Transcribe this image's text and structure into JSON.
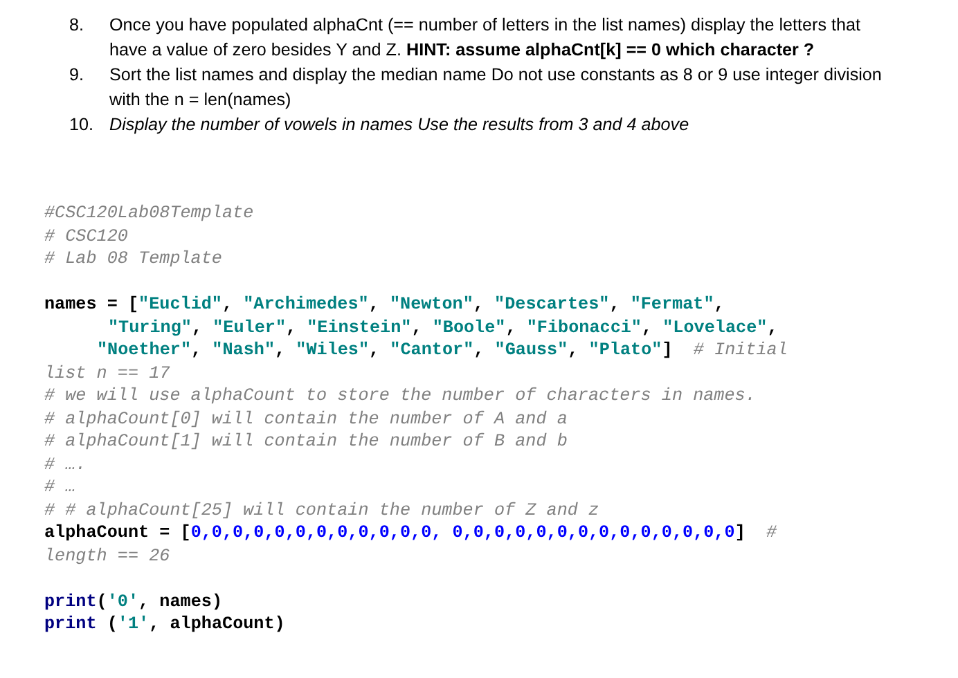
{
  "instructions": [
    {
      "number": "8.",
      "italic": false,
      "text": "Once you have populated alphaCnt (== number of letters in the list names) display the letters that have a value of zero besides Y and Z.  **HINT:  assume alphaCnt[k] == 0 which character ?**"
    },
    {
      "number": "9.",
      "italic": false,
      "text": "Sort the list names and display the median name   Do not use constants as 8 or 9 use integer division with the n = len(names)"
    },
    {
      "number": "10.",
      "italic": true,
      "text": "Display the number of vowels in names Use the results from 3 and 4 above"
    }
  ],
  "code_lines": [
    {
      "kind": "line",
      "tokens": [
        {
          "kind": "comment",
          "text": "#CSC120Lab08Template"
        }
      ]
    },
    {
      "kind": "line",
      "tokens": [
        {
          "kind": "comment",
          "text": "# CSC120"
        }
      ]
    },
    {
      "kind": "line",
      "tokens": [
        {
          "kind": "comment",
          "text": "# Lab 08 Template"
        }
      ]
    },
    {
      "kind": "line",
      "gap_before": true,
      "tokens": [
        {
          "kind": "plain",
          "text": "names = ["
        },
        {
          "kind": "string",
          "text": "\"Euclid\""
        },
        {
          "kind": "plain",
          "text": ", "
        },
        {
          "kind": "string",
          "text": "\"Archimedes\""
        },
        {
          "kind": "plain",
          "text": ", "
        },
        {
          "kind": "string",
          "text": "\"Newton\""
        },
        {
          "kind": "plain",
          "text": ", "
        },
        {
          "kind": "string",
          "text": "\"Descartes\""
        },
        {
          "kind": "plain",
          "text": ", "
        },
        {
          "kind": "string",
          "text": "\"Fermat\""
        },
        {
          "kind": "plain",
          "text": ","
        }
      ]
    },
    {
      "kind": "continuation",
      "tokens": [
        {
          "kind": "string",
          "text": "\"Turing\""
        },
        {
          "kind": "plain",
          "text": ", "
        },
        {
          "kind": "string",
          "text": "\"Euler\""
        },
        {
          "kind": "plain",
          "text": ", "
        },
        {
          "kind": "string",
          "text": "\"Einstein\""
        },
        {
          "kind": "plain",
          "text": ", "
        },
        {
          "kind": "string",
          "text": "\"Boole\""
        },
        {
          "kind": "plain",
          "text": ", "
        },
        {
          "kind": "string",
          "text": "\"Fibonacci\""
        },
        {
          "kind": "plain",
          "text": ", "
        },
        {
          "kind": "string",
          "text": "\"Lovelace\""
        },
        {
          "kind": "plain",
          "text": ","
        }
      ]
    },
    {
      "kind": "continuation_short",
      "tokens": [
        {
          "kind": "string",
          "text": "\"Noether\""
        },
        {
          "kind": "plain",
          "text": ", "
        },
        {
          "kind": "string",
          "text": "\"Nash\""
        },
        {
          "kind": "plain",
          "text": ", "
        },
        {
          "kind": "string",
          "text": "\"Wiles\""
        },
        {
          "kind": "plain",
          "text": ", "
        },
        {
          "kind": "string",
          "text": "\"Cantor\""
        },
        {
          "kind": "plain",
          "text": ", "
        },
        {
          "kind": "string",
          "text": "\"Gauss\""
        },
        {
          "kind": "plain",
          "text": ", "
        },
        {
          "kind": "string",
          "text": "\"Plato\""
        },
        {
          "kind": "plain",
          "text": "]  "
        },
        {
          "kind": "comment",
          "text": "# Initial"
        }
      ]
    },
    {
      "kind": "line",
      "tokens": [
        {
          "kind": "comment",
          "text": "list n == 17"
        }
      ]
    },
    {
      "kind": "line",
      "tokens": [
        {
          "kind": "comment",
          "text": "# we will use alphaCount to store the number of characters in names."
        }
      ]
    },
    {
      "kind": "line",
      "tokens": [
        {
          "kind": "comment",
          "text": "# alphaCount[0] will contain the number of A and a"
        }
      ]
    },
    {
      "kind": "line",
      "tokens": [
        {
          "kind": "comment",
          "text": "# alphaCount[1] will contain the number of B and b"
        }
      ]
    },
    {
      "kind": "line",
      "tokens": [
        {
          "kind": "comment",
          "text": "# …."
        }
      ]
    },
    {
      "kind": "line",
      "tokens": [
        {
          "kind": "comment",
          "text": "# …"
        }
      ]
    },
    {
      "kind": "line",
      "tokens": [
        {
          "kind": "comment",
          "text": "# # alphaCount[25] will contain the number of Z and z"
        }
      ]
    },
    {
      "kind": "line",
      "tokens": [
        {
          "kind": "plain",
          "text": "alphaCount = ["
        },
        {
          "kind": "number",
          "text": "0,0,0,0,0,0,0,0,0,0,0,0, 0,0,0,0,0,0,0,0,0,0,0,0,0,0"
        },
        {
          "kind": "plain",
          "text": "]  "
        },
        {
          "kind": "comment",
          "text": "#"
        }
      ]
    },
    {
      "kind": "line",
      "tokens": [
        {
          "kind": "comment",
          "text": "length == 26"
        }
      ]
    },
    {
      "kind": "line",
      "gap_before": true,
      "tokens": [
        {
          "kind": "keyword",
          "text": "print"
        },
        {
          "kind": "plain",
          "text": "("
        },
        {
          "kind": "string",
          "text": "'0'"
        },
        {
          "kind": "plain",
          "text": ", names)"
        }
      ]
    },
    {
      "kind": "line",
      "tokens": [
        {
          "kind": "keyword",
          "text": "print"
        },
        {
          "kind": "plain",
          "text": " ("
        },
        {
          "kind": "string",
          "text": "'1'"
        },
        {
          "kind": "plain",
          "text": ", alphaCount)"
        }
      ]
    }
  ]
}
